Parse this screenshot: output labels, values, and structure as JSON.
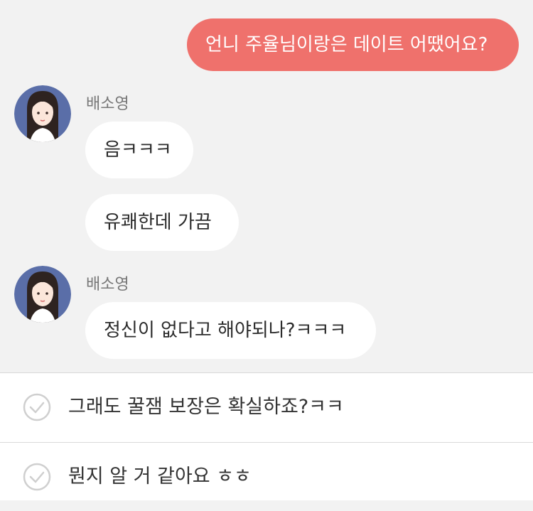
{
  "messages": {
    "outgoing_1": "언니 주율님이랑은 데이트 어땠어요?",
    "group_1": {
      "sender": "배소영",
      "bubbles": [
        "음ㅋㅋㅋ",
        "유쾌한데 가끔"
      ]
    },
    "group_2": {
      "sender": "배소영",
      "bubbles": [
        "정신이 없다고 해야되나?ㅋㅋㅋ"
      ]
    }
  },
  "reply_options": [
    "그래도 꿀잼 보장은 확실하죠?ㅋㅋ",
    "뭔지 알 거 같아요 ㅎㅎ"
  ],
  "colors": {
    "outgoing_bubble": "#ef716c",
    "incoming_bubble": "#ffffff",
    "chat_background": "#f2f2f2"
  },
  "icons": {
    "reply_option": "check-circle-icon",
    "avatar": "avatar-girl-portrait"
  }
}
